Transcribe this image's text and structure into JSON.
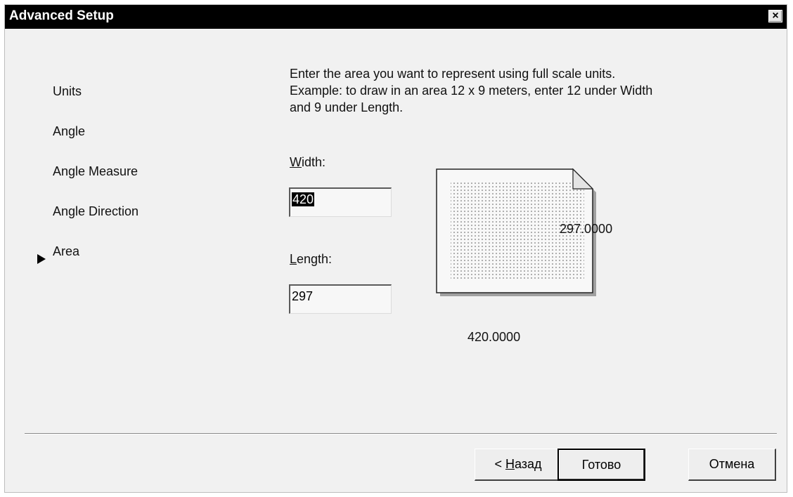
{
  "window": {
    "title": "Advanced Setup",
    "close_label": "×"
  },
  "nav": {
    "items": [
      {
        "label": "Units",
        "active": false
      },
      {
        "label": "Angle",
        "active": false
      },
      {
        "label": "Angle Measure",
        "active": false
      },
      {
        "label": "Angle Direction",
        "active": false
      },
      {
        "label": "Area",
        "active": true
      }
    ]
  },
  "area": {
    "description": "Enter the area you want to represent using full scale units.  Example: to draw in an area 12 x 9 meters, enter 12 under Width and 9 under Length.",
    "width_label_mnemonic": "W",
    "width_label_rest": "idth:",
    "width_value": "420",
    "length_label_mnemonic": "L",
    "length_label_rest": "ength:",
    "length_value": "297",
    "preview_height_label": "297.0000",
    "preview_width_label": "420.0000"
  },
  "buttons": {
    "back_prefix": "< ",
    "back_mnemonic": "Н",
    "back_rest": "азад",
    "finish": "Готово",
    "cancel": "Отмена"
  }
}
